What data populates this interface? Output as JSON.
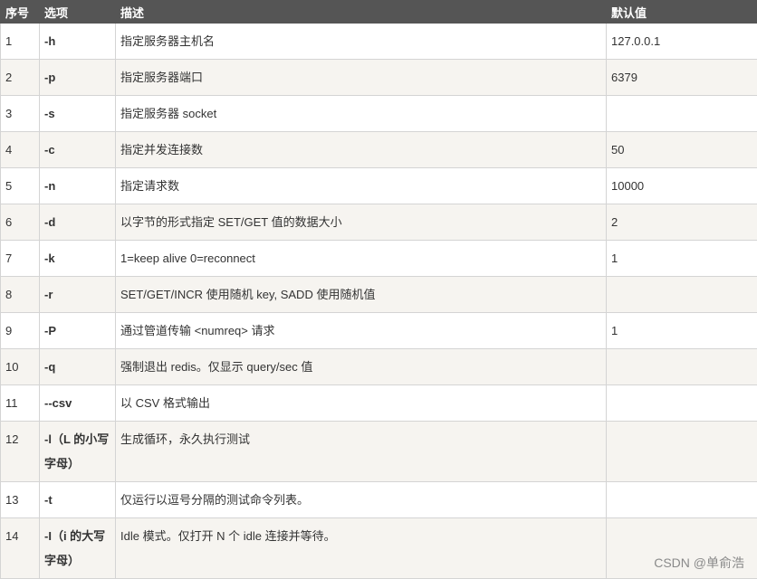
{
  "table": {
    "headers": [
      "序号",
      "选项",
      "描述",
      "默认值"
    ],
    "rows": [
      {
        "no": "1",
        "option": "-h",
        "desc": "指定服务器主机名",
        "default": "127.0.0.1"
      },
      {
        "no": "2",
        "option": "-p",
        "desc": "指定服务器端口",
        "default": "6379"
      },
      {
        "no": "3",
        "option": "-s",
        "desc": "指定服务器 socket",
        "default": ""
      },
      {
        "no": "4",
        "option": "-c",
        "desc": "指定并发连接数",
        "default": "50"
      },
      {
        "no": "5",
        "option": "-n",
        "desc": "指定请求数",
        "default": "10000"
      },
      {
        "no": "6",
        "option": "-d",
        "desc": "以字节的形式指定 SET/GET 值的数据大小",
        "default": "2"
      },
      {
        "no": "7",
        "option": "-k",
        "desc": "1=keep alive 0=reconnect",
        "default": "1"
      },
      {
        "no": "8",
        "option": "-r",
        "desc": "SET/GET/INCR 使用随机 key, SADD 使用随机值",
        "default": ""
      },
      {
        "no": "9",
        "option": "-P",
        "desc": "通过管道传输 <numreq> 请求",
        "default": "1"
      },
      {
        "no": "10",
        "option": "-q",
        "desc": "强制退出 redis。仅显示 query/sec 值",
        "default": ""
      },
      {
        "no": "11",
        "option": "--csv",
        "desc": "以 CSV 格式输出",
        "default": ""
      },
      {
        "no": "12",
        "option": "-l（L 的小写字母）",
        "desc": "生成循环，永久执行测试",
        "default": ""
      },
      {
        "no": "13",
        "option": "-t",
        "desc": "仅运行以逗号分隔的测试命令列表。",
        "default": ""
      },
      {
        "no": "14",
        "option": "-I（i 的大写字母）",
        "desc": "Idle 模式。仅打开 N 个 idle 连接并等待。",
        "default": ""
      }
    ]
  },
  "watermark": "CSDN @单俞浩"
}
